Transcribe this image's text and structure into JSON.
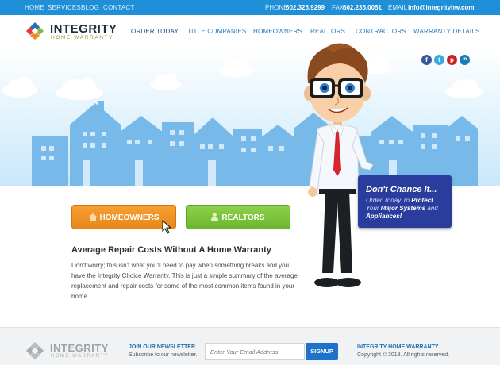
{
  "topbar": {
    "links": [
      "HOME",
      "SERVICES",
      "BLOG",
      "CONTACT"
    ],
    "phone_label": "PHONE",
    "phone": "602.325.9299",
    "fax_label": "FAX",
    "fax": "602.235.0051",
    "email_label": "EMAIL",
    "email": "info@integrityhw.com"
  },
  "header": {
    "logo_title": "INTEGRITY",
    "logo_subtitle": "HOME WARRANTY",
    "nav": [
      "ORDER TODAY",
      "TITLE COMPANIES",
      "HOMEOWNERS",
      "REALTORS",
      "CONTRACTORS",
      "WARRANTY DETAILS"
    ]
  },
  "social": {
    "icons": [
      "facebook-icon",
      "twitter-icon",
      "pinterest-icon",
      "linkedin-icon"
    ],
    "letters": [
      "f",
      "t",
      "p",
      "in"
    ],
    "colors": [
      "#3b5998",
      "#3aaae0",
      "#cb2027",
      "#1b7ab8"
    ]
  },
  "hero": {
    "sky_color": "#c9e8fa",
    "houses_color": "#77b9e8"
  },
  "buttons": {
    "homeowners": "HOMEOWNERS",
    "realtors": "REALTORS",
    "homeowners_color": "#f39a2d",
    "realtors_color": "#7cc33d"
  },
  "content": {
    "title": "Average Repair Costs Without A Home Warranty",
    "body": "Don't worry; this isn't what you'll need to pay when something breaks and you have the Integrity Choice Warranty. This is just a simple summary of the average replacement and repair costs for some of the most common items found in your home."
  },
  "callout": {
    "title": "Don't Chance It...",
    "line1": "Order Today To ",
    "line1_strong": "Protect",
    "line2_pre": "Your ",
    "line2_strong": "Major Systems",
    "line2_post": " and",
    "line3_strong": "Appliances!"
  },
  "footer": {
    "logo_title": "INTEGRITY",
    "logo_subtitle": "HOME WARRANTY",
    "newsletter_title": "JOIN OUR NEWSLETTER",
    "newsletter_sub": "Subscribe to our newsletter.",
    "email_placeholder": "Enter Your Email Address",
    "signup": "SIGNUP",
    "brand": "INTEGRITY HOME WARRANTY",
    "copyright": "Copyright © 2013. All rights reserved."
  }
}
